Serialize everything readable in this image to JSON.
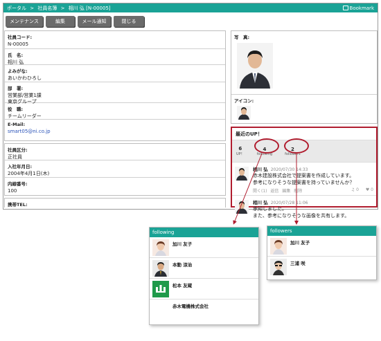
{
  "breadcrumb": {
    "home": "ポータル",
    "sep": ">",
    "section": "社員名簿",
    "current": "相川 弘 [N-00005]"
  },
  "bookmark": {
    "label": "Bookmark",
    "icon": "book-icon"
  },
  "toolbar": {
    "maintenance": "メンテナンス",
    "edit": "編集",
    "mail_notify": "メール通知",
    "close": "閉じる"
  },
  "profile": {
    "code_label": "社員コード:",
    "code": "N-00005",
    "name_label": "氏　名:",
    "name": "相川 弘",
    "kana_label": "よみがな:",
    "kana": "あいかわひろし",
    "dept_label": "部　署:",
    "dept_1": "営業部/営業1課",
    "dept_2": "東京グループ",
    "role_label": "役　職:",
    "role": "チームリーダー",
    "email_label": "E-Mail:",
    "email": "smart05@ni.co.jp"
  },
  "employment": {
    "class_label": "社員区分:",
    "class": "正社員",
    "joined_label": "入社年月日:",
    "joined": "2004年4月1日(木)",
    "ext_label": "内線番号:",
    "ext": "100"
  },
  "mobile": {
    "label": "携帯TEL:"
  },
  "photo": {
    "label": "写　真:",
    "icon_label": "アイコン:"
  },
  "feed": {
    "title": "最近のUP！",
    "stats": [
      {
        "num": "6",
        "cap": "UP！"
      },
      {
        "num": "4",
        "cap": "following"
      },
      {
        "num": "2",
        "cap": "followers"
      }
    ],
    "posts": [
      {
        "author": "相川 弘",
        "date": "2020/07/30 14:33",
        "line1": "赤木建設株式会社で提案書を作成しています。",
        "line2": "参考になりそうな提案書を持っていませんか？",
        "act_open": "開く(1)",
        "act_reply": "返信",
        "act_edit": "編集",
        "act_delete": "削除",
        "music_count": "0",
        "heart_count": "0"
      },
      {
        "author": "相川 弘",
        "date": "2020/07/28 11:06",
        "line1": "承知しました。",
        "line2": "また、参考になりそうな画像を共有します。"
      }
    ]
  },
  "following_popup": {
    "title": "following",
    "users": [
      {
        "name": "加川 友子"
      },
      {
        "name": "本動 涼治"
      },
      {
        "name": "松本 友蔵"
      },
      {
        "name": "赤木電機株式会社"
      }
    ]
  },
  "followers_popup": {
    "title": "followers",
    "users": [
      {
        "name": "加川 友子"
      },
      {
        "name": "三浦 咲"
      }
    ]
  },
  "colors": {
    "accent": "#1aa396",
    "highlight": "#b01c2e",
    "button": "#6b6b6b"
  }
}
